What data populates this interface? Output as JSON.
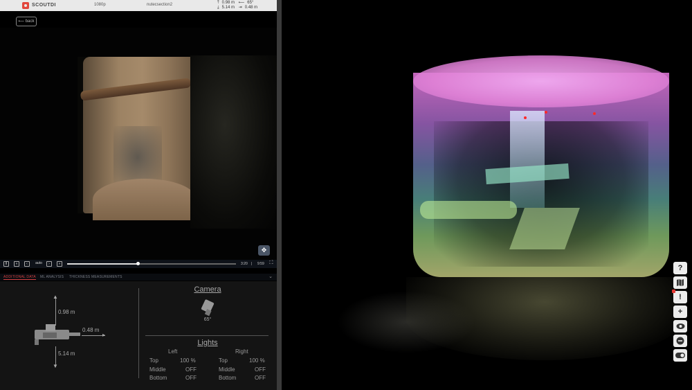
{
  "topbar": {
    "logo": "SCOUTDI",
    "resolution": "1080p",
    "section": "nutecsection2",
    "stats": {
      "up": "0.98 m",
      "angle": "65°",
      "down": "5.14 m",
      "right": "0.48 m"
    }
  },
  "back_label": "back",
  "controls": {
    "play_pause": "II",
    "prev": "«",
    "frame_back": "‹",
    "speed": "auto",
    "frame_fwd": "›",
    "next": "»",
    "elapsed": "3:20",
    "sep": "|",
    "total": "9:59",
    "progress": 0.42
  },
  "tabs": [
    {
      "label": "ADDITIONAL DATA",
      "active": true
    },
    {
      "label": "ML ANALYSIS",
      "active": false
    },
    {
      "label": "THICKNESS MEASUREMENTS",
      "active": false
    }
  ],
  "crawler": {
    "up": "0.98 m",
    "right": "0.48 m",
    "down": "5.14 m"
  },
  "camera": {
    "title": "Camera",
    "angle": "65°"
  },
  "lights": {
    "title": "Lights",
    "left_header": "Left",
    "right_header": "Right",
    "left": [
      {
        "pos": "Top",
        "val": "100 %"
      },
      {
        "pos": "Middle",
        "val": "OFF"
      },
      {
        "pos": "Bottom",
        "val": "OFF"
      }
    ],
    "right": [
      {
        "pos": "Top",
        "val": "100 %"
      },
      {
        "pos": "Middle",
        "val": "OFF"
      },
      {
        "pos": "Bottom",
        "val": "OFF"
      }
    ]
  },
  "toolbar": {
    "help": "?",
    "map_icon": "map-icon",
    "alert": "!",
    "add": "+",
    "eye_icon": "eye-icon",
    "minus": "−",
    "toggle_icon": "toggle-icon"
  },
  "colors": {
    "accent": "#e2463c",
    "tab_active": "#d04040",
    "expand_btn": "#4a5566"
  }
}
